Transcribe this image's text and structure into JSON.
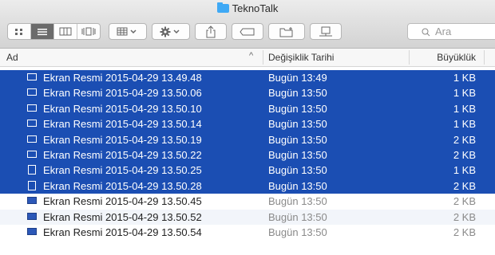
{
  "window": {
    "title": "TeknoTalk"
  },
  "toolbar": {
    "view_buttons": [
      "icon-view-icon",
      "list-view-icon",
      "column-view-icon",
      "cover-flow-icon"
    ],
    "arrange_icon": "arrange-icon",
    "action_icon": "gear-icon",
    "share_icon": "share-icon",
    "tag_icon": "tag-icon",
    "new_folder_icon": "new-folder-icon",
    "connect_icon": "connect-icon",
    "search_placeholder": "Ara"
  },
  "columns": {
    "name": "Ad",
    "date": "Değişiklik Tarihi",
    "size": "Büyüklük",
    "sort_indicator": "^"
  },
  "colors": {
    "selection": "#1b4eb3",
    "folder": "#3fa9f5"
  },
  "files": [
    {
      "name": "Ekran Resmi 2015-04-29 13.49.48",
      "date": "Bugün 13:49",
      "size": "1 KB",
      "selected": true,
      "icon": "wide"
    },
    {
      "name": "Ekran Resmi 2015-04-29 13.50.06",
      "date": "Bugün 13:50",
      "size": "1 KB",
      "selected": true,
      "icon": "wide"
    },
    {
      "name": "Ekran Resmi 2015-04-29 13.50.10",
      "date": "Bugün 13:50",
      "size": "1 KB",
      "selected": true,
      "icon": "wide"
    },
    {
      "name": "Ekran Resmi 2015-04-29 13.50.14",
      "date": "Bugün 13:50",
      "size": "1 KB",
      "selected": true,
      "icon": "wide"
    },
    {
      "name": "Ekran Resmi 2015-04-29 13.50.19",
      "date": "Bugün 13:50",
      "size": "2 KB",
      "selected": true,
      "icon": "wide"
    },
    {
      "name": "Ekran Resmi 2015-04-29 13.50.22",
      "date": "Bugün 13:50",
      "size": "2 KB",
      "selected": true,
      "icon": "wide"
    },
    {
      "name": "Ekran Resmi 2015-04-29 13.50.25",
      "date": "Bugün 13:50",
      "size": "1 KB",
      "selected": true,
      "icon": "tall"
    },
    {
      "name": "Ekran Resmi 2015-04-29 13.50.28",
      "date": "Bugün 13:50",
      "size": "2 KB",
      "selected": true,
      "icon": "tall"
    },
    {
      "name": "Ekran Resmi 2015-04-29 13.50.45",
      "date": "Bugün 13:50",
      "size": "2 KB",
      "selected": false,
      "icon": "blue"
    },
    {
      "name": "Ekran Resmi 2015-04-29 13.50.52",
      "date": "Bugün 13:50",
      "size": "2 KB",
      "selected": false,
      "icon": "blue"
    },
    {
      "name": "Ekran Resmi 2015-04-29 13.50.54",
      "date": "Bugün 13:50",
      "size": "2 KB",
      "selected": false,
      "icon": "blue"
    }
  ]
}
